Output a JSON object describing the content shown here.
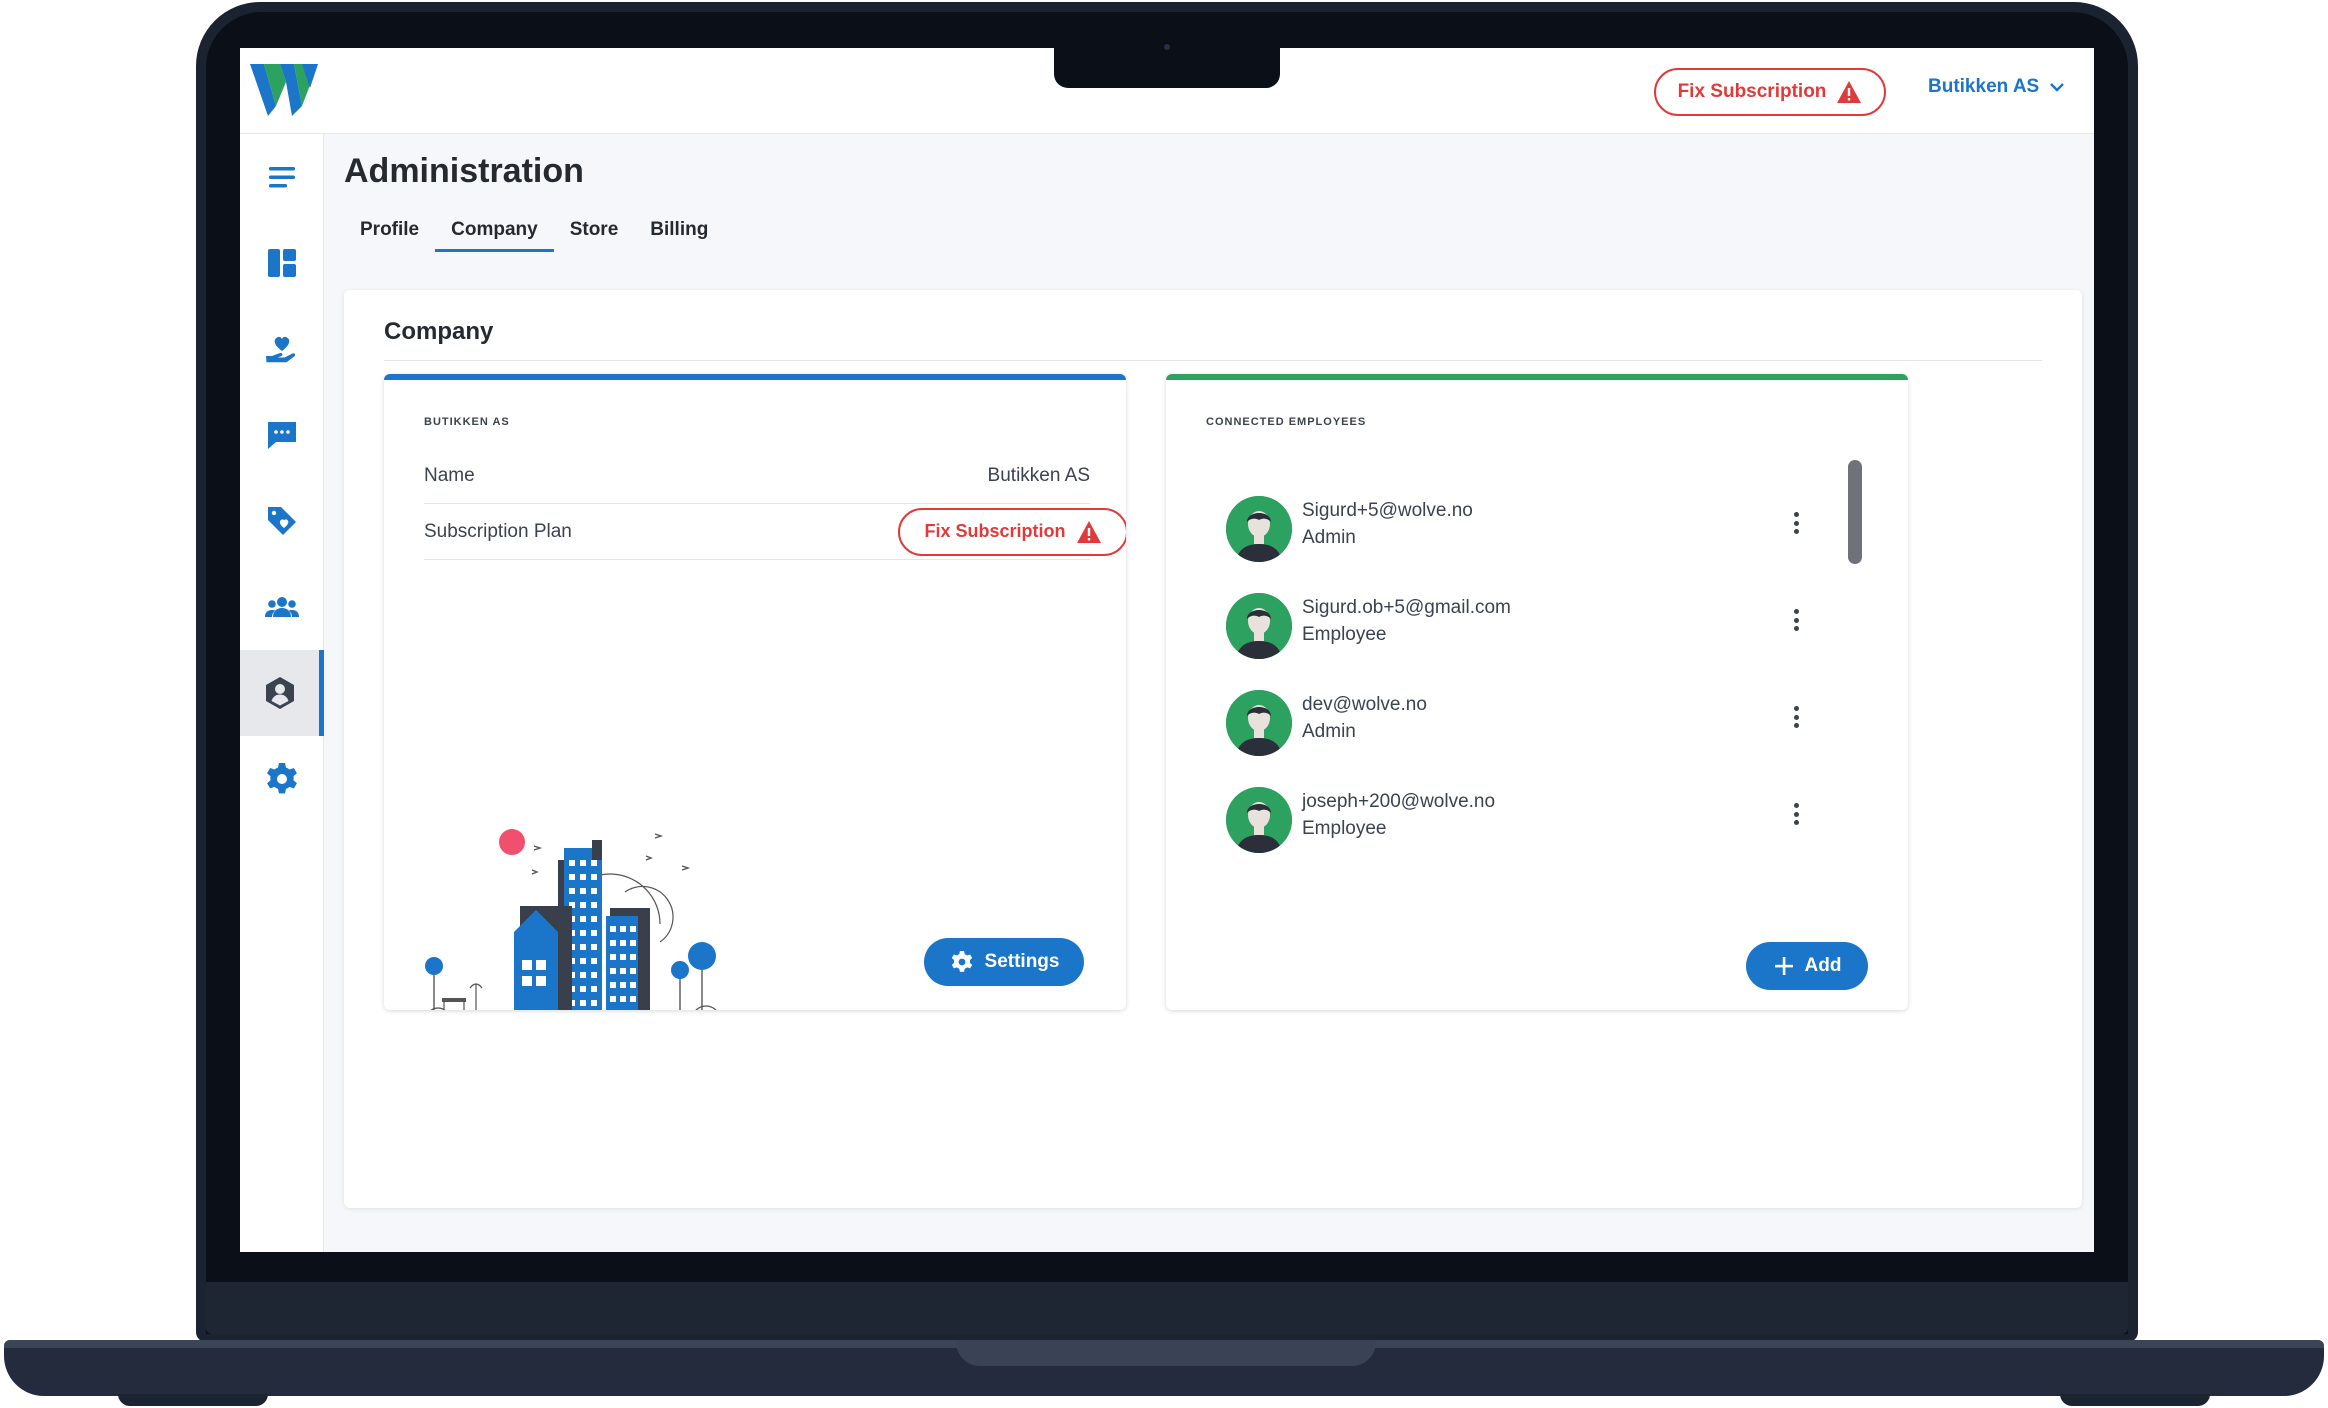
{
  "topbar": {
    "fix_subscription_label": "Fix Subscription",
    "company_name": "Butikken AS"
  },
  "sidebar": {
    "items": [
      {
        "name": "menu",
        "icon": "hamburger-menu-icon"
      },
      {
        "name": "dashboard",
        "icon": "dashboard-icon"
      },
      {
        "name": "care",
        "icon": "heart-hand-icon"
      },
      {
        "name": "messages",
        "icon": "chat-icon"
      },
      {
        "name": "offers",
        "icon": "tag-heart-icon"
      },
      {
        "name": "customers",
        "icon": "people-icon"
      },
      {
        "name": "administration",
        "icon": "user-shield-icon",
        "active": true
      },
      {
        "name": "settings",
        "icon": "gear-icon"
      }
    ]
  },
  "page": {
    "title": "Administration",
    "tabs": [
      {
        "label": "Profile"
      },
      {
        "label": "Company",
        "active": true
      },
      {
        "label": "Store"
      },
      {
        "label": "Billing"
      }
    ]
  },
  "company_panel": {
    "title": "Company",
    "company_card": {
      "label": "BUTIKKEN AS",
      "rows": [
        {
          "key": "Name",
          "value": "Butikken AS"
        },
        {
          "key": "Subscription Plan",
          "value": "Fix Subscription"
        }
      ],
      "settings_button": "Settings"
    },
    "employees_card": {
      "label": "CONNECTED EMPLOYEES",
      "employees": [
        {
          "email": "Sigurd+5@wolve.no",
          "role": "Admin"
        },
        {
          "email": "Sigurd.ob+5@gmail.com",
          "role": "Employee"
        },
        {
          "email": "dev@wolve.no",
          "role": "Admin"
        },
        {
          "email": "joseph+200@wolve.no",
          "role": "Employee"
        }
      ],
      "add_button": "Add"
    }
  },
  "colors": {
    "accent": "#1b75c9",
    "danger": "#e03a3a",
    "success": "#2da160"
  }
}
